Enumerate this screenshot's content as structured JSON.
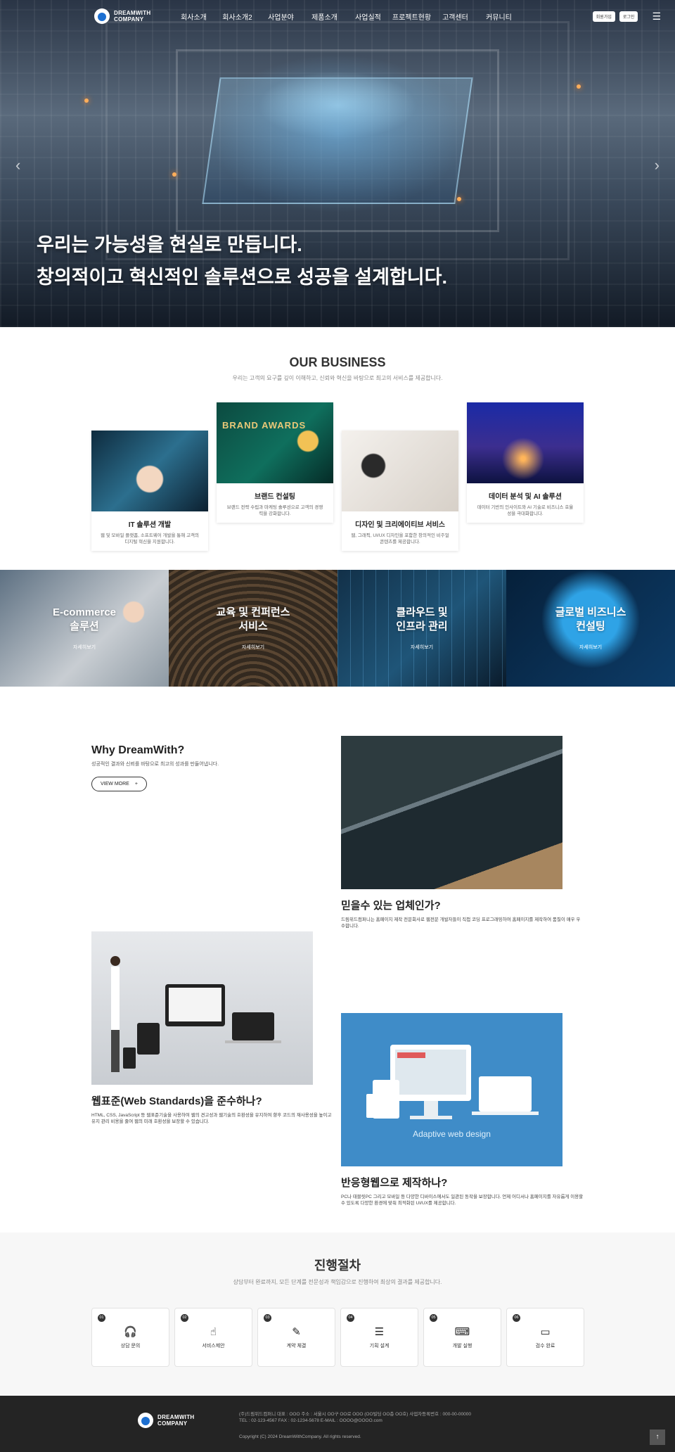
{
  "header": {
    "logo_line1": "DREAMWITH",
    "logo_line2": "COMPANY",
    "menu": [
      "회사소개",
      "회사소개2",
      "사업분야",
      "제품소개",
      "사업실적",
      "프로젝트현황",
      "고객센터",
      "커뮤니티"
    ],
    "login": "회원가입",
    "join": "로그인"
  },
  "hero": {
    "line1": "우리는 가능성을 현실로 만듭니다.",
    "line2": "창의적이고 혁신적인 솔루션으로 성공을 설계합니다."
  },
  "business": {
    "title": "OUR BUSINESS",
    "subtitle": "우리는 고객의 요구를 깊이 이해하고, 신뢰와 혁신을 바탕으로 최고의 서비스를 제공합니다.",
    "cards": [
      {
        "title": "IT 솔루션 개발",
        "desc": "웹 및 모바일 플랫폼, 소프트웨어 개발을 통해 고객의 디지털 혁신을 지원합니다."
      },
      {
        "title": "브랜드 컨설팅",
        "desc": "브랜드 전략 수립과 마케팅 솔루션으로 고객의 경쟁력을 강화합니다.",
        "image_text": "BRAND AWARDS"
      },
      {
        "title": "디자인 및 크리에이티브 서비스",
        "desc": "웹, 그래픽, UI/UX 디자인을 포함한 창의적인 비주얼 콘텐츠를 제공합니다."
      },
      {
        "title": "데이터 분석 및 AI 솔루션",
        "desc": "데이터 기반의 인사이트와 AI 기술로 비즈니스 효율성을 극대화합니다."
      }
    ]
  },
  "services": [
    {
      "title": "E-commerce\n솔루션",
      "more": "자세히보기"
    },
    {
      "title": "교육 및 컨퍼런스\n서비스",
      "more": "자세히보기"
    },
    {
      "title": "클라우드 및\n인프라 관리",
      "more": "자세히보기"
    },
    {
      "title": "글로벌 비즈니스\n컨설팅",
      "more": "자세히보기"
    }
  ],
  "why": {
    "title": "Why DreamWith?",
    "subtitle": "성공적인 결과와 신뢰를 바탕으로 최고의 성과를 만들어냅니다.",
    "button": "VIEW MORE",
    "features": [
      {
        "title": "믿을수 있는 업체인가?",
        "desc": "드림위드컴퍼니는 홈페이지 제작 전문회사로 웹전문 개발자들이 직접 코딩 프로그래밍하여 홈페이지를 제작하여 품질이 매우 우수합니다."
      },
      {
        "title": "웹표준(Web Standards)을 준수하나?",
        "desc": "HTML, CSS, JavaScript 등 웹표준기술을 사용하여 웹의 견고성과 웹기술의 호환성을 유지하여 향후 코드의 재사용성을 높이고 유지 관리 비용을 줄여 웹의 미래 호환성을 보장할 수 있습니다."
      },
      {
        "title": "반응형웹으로 제작하나?",
        "desc": "PC나 태블릿PC 그리고 모바일 등 다양한 디바이스에서도 일관된 동작을 보장합니다. 언제 어디서나 홈페이지를 자유롭게 이용할 수 있도록 다양한 환경에 맞춰 최적화된 UI/UX를 제공합니다.",
        "image_text": "Adaptive web design"
      }
    ]
  },
  "process": {
    "title": "진행절차",
    "subtitle": "상담부터 완료까지, 모든 단계를 전문성과 책임감으로 진행하여 최상의 결과를 제공합니다.",
    "steps": [
      {
        "num": "01",
        "label": "상담 문의",
        "icon": "headset-icon"
      },
      {
        "num": "02",
        "label": "서비스제안",
        "icon": "hand-pointer-icon"
      },
      {
        "num": "03",
        "label": "계약 체결",
        "icon": "edit-icon"
      },
      {
        "num": "04",
        "label": "기획 설계",
        "icon": "sliders-icon"
      },
      {
        "num": "05",
        "label": "개발 실행",
        "icon": "code-icon"
      },
      {
        "num": "06",
        "label": "검수 완료",
        "icon": "monitor-icon"
      }
    ]
  },
  "footer": {
    "line1": "(주)드림위드컴퍼니   대표 : OOO    주소 : 서울시 OO구 OO로 OOO (OO빌딩 OO층 OO호)    사업자등록번호 : 000-00-00000",
    "line2": "TEL : 02-123-4567    FAX : 02-1234-5678    E-MAIL : OOOO@OOOO.com",
    "copyright": "Copyright (C) 2024 DreamWithCompany. All rights reserved.",
    "top": "↑"
  },
  "colors": {
    "accent": "#1c6fd1",
    "footer_bg": "#242424",
    "process_bg": "#f7f7f7",
    "adaptive_bg": "#3f8cc8"
  }
}
